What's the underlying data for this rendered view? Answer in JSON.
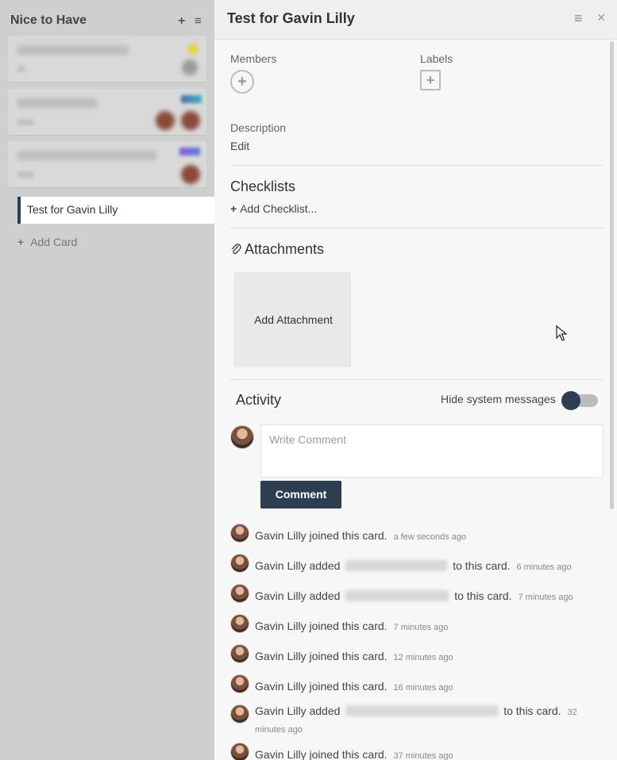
{
  "list": {
    "title": "Nice to Have",
    "active_card": "Test for Gavin Lilly",
    "add_card_label": "Add Card",
    "add_icon": "+",
    "menu_icon": "≡"
  },
  "panel": {
    "title": "Test for Gavin Lilly",
    "menu_icon": "≡",
    "close_icon": "×",
    "members_label": "Members",
    "labels_label": "Labels",
    "description_label": "Description",
    "description_edit": "Edit",
    "checklists_heading": "Checklists",
    "add_checklist": "Add Checklist...",
    "attachments_heading": "Attachments",
    "add_attachment": "Add Attachment",
    "activity_heading": "Activity",
    "hide_system_messages": "Hide system messages",
    "comment_placeholder": "Write Comment",
    "comment_button": "Comment"
  },
  "activity": [
    {
      "user": "Gavin Lilly",
      "text": "joined this card.",
      "time": "a few seconds ago"
    },
    {
      "user": "Gavin Lilly",
      "text": "added",
      "after": "to this card.",
      "time": "6 minutes ago"
    },
    {
      "user": "Gavin Lilly",
      "text": "added",
      "after": "to this card.",
      "time": "7 minutes ago"
    },
    {
      "user": "Gavin Lilly",
      "text": "joined this card.",
      "time": "7 minutes ago"
    },
    {
      "user": "Gavin Lilly",
      "text": "joined this card.",
      "time": "12 minutes ago"
    },
    {
      "user": "Gavin Lilly",
      "text": "joined this card.",
      "time": "16 minutes ago"
    },
    {
      "user": "Gavin Lilly",
      "text": "added",
      "after": "to this card.",
      "time": "32 minutes ago"
    },
    {
      "user": "Gavin Lilly",
      "text": "joined this card.",
      "time": "37 minutes ago"
    }
  ]
}
